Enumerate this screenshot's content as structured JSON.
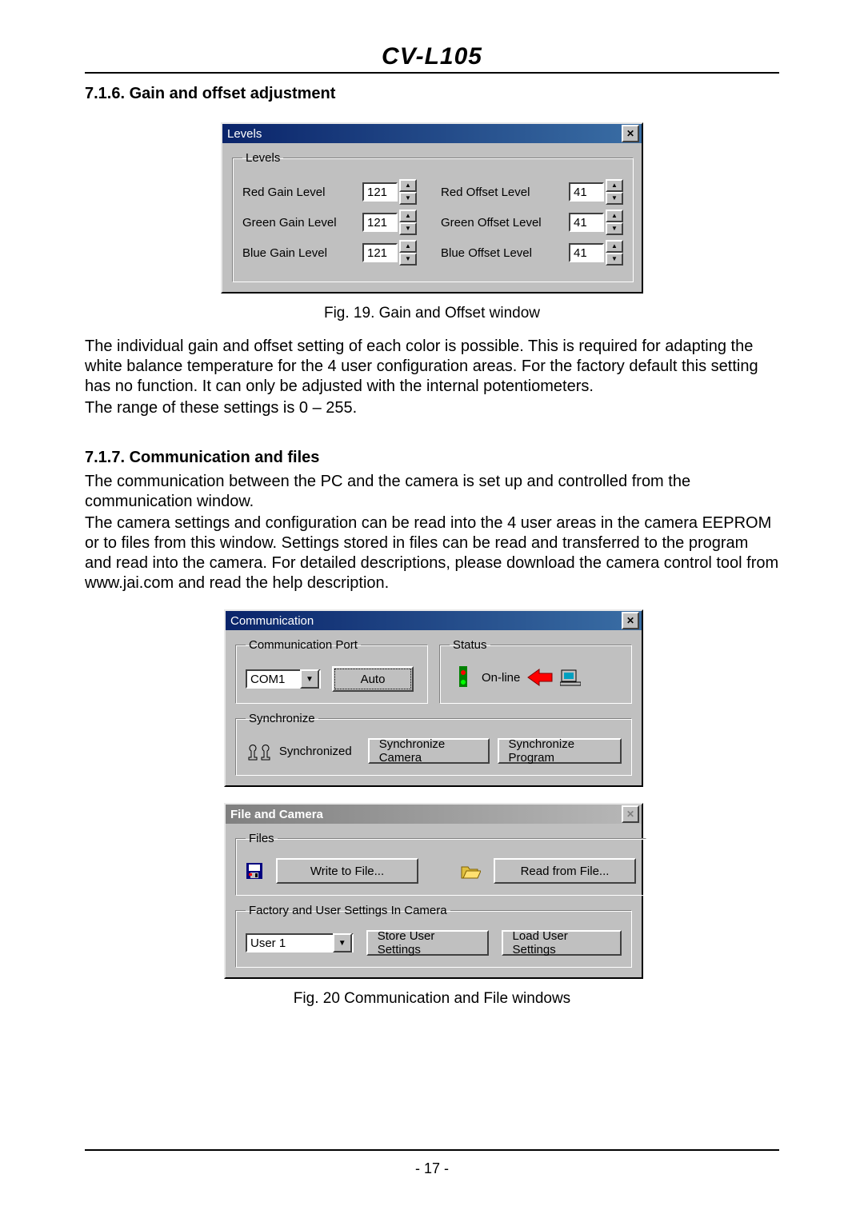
{
  "doc": {
    "title": "CV-L105",
    "page_num": "- 17 -"
  },
  "sec1": {
    "heading": "7.1.6. Gain and offset adjustment",
    "fig_caption": "Fig. 19. Gain and Offset window",
    "para1": "The individual gain and offset setting of each color is possible. This is required for adapting the white balance temperature for the 4 user configuration areas.  For the factory default this setting has no function. It can only be adjusted with the internal potentiometers.",
    "para2": "The range of these settings is 0 – 255."
  },
  "sec2": {
    "heading": "7.1.7. Communication and files",
    "para1": "The communication between the PC and the camera is set up and controlled from the communication window.",
    "para2": "The camera settings and configuration can be read into the 4 user areas in the camera EEPROM or to files from this window. Settings stored in files can be read and transferred to the program and read into the camera. For detailed descriptions, please download the camera control tool from www.jai.com and read the help description.",
    "fig_caption": "Fig. 20 Communication and File windows"
  },
  "levels_win": {
    "title": "Levels",
    "group": "Levels",
    "rows": [
      {
        "gain_label": "Red Gain Level",
        "gain_val": "121",
        "off_label": "Red Offset Level",
        "off_val": "41"
      },
      {
        "gain_label": "Green Gain Level",
        "gain_val": "121",
        "off_label": "Green Offset Level",
        "off_val": "41"
      },
      {
        "gain_label": "Blue Gain Level",
        "gain_val": "121",
        "off_label": "Blue Offset Level",
        "off_val": "41"
      }
    ]
  },
  "comm_win": {
    "title": "Communication",
    "port_group": "Communication Port",
    "port_value": "COM1",
    "auto_btn": "Auto",
    "status_group": "Status",
    "status_text": "On-line",
    "sync_group": "Synchronize",
    "sync_text": "Synchronized",
    "sync_cam_btn": "Synchronize Camera",
    "sync_prog_btn": "Synchronize Program"
  },
  "file_win": {
    "title": "File and Camera",
    "files_group": "Files",
    "write_btn": "Write to File...",
    "read_btn": "Read from File...",
    "fact_group": "Factory and User Settings In Camera",
    "user_value": "User 1",
    "store_btn": "Store User Settings",
    "load_btn": "Load User Settings"
  }
}
